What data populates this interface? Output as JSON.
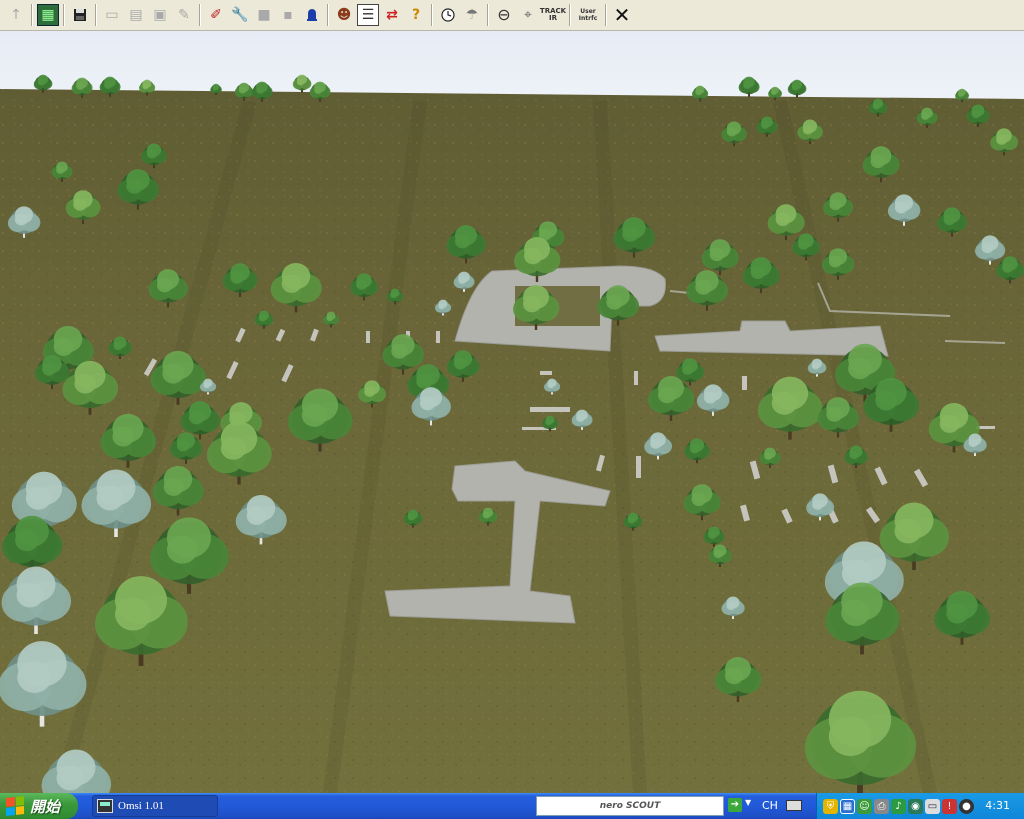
{
  "toolbar": {
    "buttons": [
      {
        "icon": "up-arrow-icon",
        "glyph": "↑",
        "enabled": false
      },
      {
        "icon": "map-icon",
        "glyph": "▦",
        "enabled": true
      },
      {
        "icon": "save-icon",
        "glyph": "💾",
        "enabled": true
      },
      {
        "icon": "new-icon",
        "glyph": "▭",
        "enabled": false
      },
      {
        "icon": "tile-icon",
        "glyph": "▤",
        "enabled": false
      },
      {
        "icon": "frame-icon",
        "glyph": "▣",
        "enabled": false
      },
      {
        "icon": "brush-icon",
        "glyph": "✎",
        "enabled": false
      },
      {
        "icon": "spline-icon",
        "glyph": "✐",
        "enabled": true
      },
      {
        "icon": "wrench-icon",
        "glyph": "🔧",
        "enabled": true
      },
      {
        "icon": "gray-block-icon",
        "glyph": "■",
        "enabled": false
      },
      {
        "icon": "gray-block2-icon",
        "glyph": "▪",
        "enabled": false
      },
      {
        "icon": "bell-icon",
        "glyph": "🔔",
        "enabled": true
      },
      {
        "icon": "person-icon",
        "glyph": "☻",
        "enabled": true
      },
      {
        "icon": "list-icon",
        "glyph": "☰",
        "enabled": true
      },
      {
        "icon": "swap-icon",
        "glyph": "⇄",
        "enabled": true
      },
      {
        "icon": "help-icon",
        "glyph": "?",
        "enabled": true
      },
      {
        "icon": "clock-icon",
        "glyph": "🕓",
        "enabled": true
      },
      {
        "icon": "weather-icon",
        "glyph": "☂",
        "enabled": true
      },
      {
        "icon": "view-icon",
        "glyph": "⊖",
        "enabled": true
      },
      {
        "icon": "mouse-icon",
        "glyph": "⌖",
        "enabled": true
      },
      {
        "icon": "trackir-icon",
        "glyph": "TRACK IR",
        "enabled": true
      },
      {
        "icon": "user-interface-icon",
        "glyph": "User Intrfc",
        "enabled": true
      },
      {
        "icon": "close-icon",
        "glyph": "✕",
        "enabled": true
      }
    ]
  },
  "taskbar": {
    "start_label": "開始",
    "task_label": "Omsi 1.01",
    "search_logo": "nero SCOUT",
    "go_glyph": "➔",
    "language": "CH",
    "clock": "4:31"
  },
  "tray_icons": [
    "shield-icon",
    "network-icon",
    "msn-icon",
    "printer-icon",
    "speaker-icon",
    "disk-icon",
    "monitor-icon",
    "alert-icon",
    "media-icon"
  ],
  "colors": {
    "sky": "#e8eef6",
    "grass": "#6e6a3c",
    "pavement": "#b3b3ae",
    "taskbar_blue": "#245edc",
    "start_green": "#3c9a3c"
  }
}
